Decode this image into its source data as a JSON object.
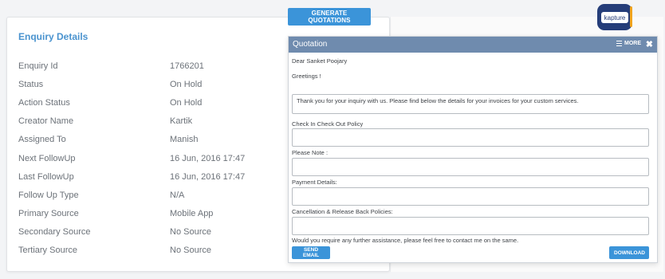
{
  "enquiry": {
    "title": "Enquiry Details",
    "rows": [
      {
        "label": "Enquiry Id",
        "value": "1766201"
      },
      {
        "label": "Status",
        "value": "On Hold"
      },
      {
        "label": "Action Status",
        "value": "On Hold"
      },
      {
        "label": "Creator Name",
        "value": "Kartik"
      },
      {
        "label": "Assigned To",
        "value": "Manish"
      },
      {
        "label": "Next FollowUp",
        "value": "16 Jun, 2016 17:47"
      },
      {
        "label": "Last FollowUp",
        "value": "16 Jun, 2016 17:47"
      },
      {
        "label": "Follow Up Type",
        "value": "N/A"
      },
      {
        "label": "Primary Source",
        "value": "Mobile App"
      },
      {
        "label": "Secondary Source",
        "value": "No Source"
      },
      {
        "label": "Tertiary Source",
        "value": "No Source"
      }
    ]
  },
  "toolbar": {
    "generate_label": "GENERATE QUOTATIONS"
  },
  "logo": {
    "text": "kapture"
  },
  "quotation": {
    "title": "Quotation",
    "more_label": "MORE",
    "close_glyph": "✖",
    "greeting_name": "Dear Sanket Poojary",
    "greeting": "Greetings !",
    "intro_text": "Thank you for your inquiry with us. Please find below the details for your invoices for your custom services.",
    "check_policy_label": "Check In Check Out Policy",
    "note_label": "Please Note :",
    "payment_label": "Payment Details:",
    "cancellation_label": "Cancellation & Release Back Policies:",
    "footer_text": "Would you require any further assistance, please feel free to contact me on the same.",
    "send_label": "SEND EMAIL",
    "download_label": "DOWNLOAD"
  },
  "colors": {
    "accent": "#3b94d9",
    "header": "#6f8bae",
    "title": "#4a93cf",
    "logo": "#253d79"
  }
}
